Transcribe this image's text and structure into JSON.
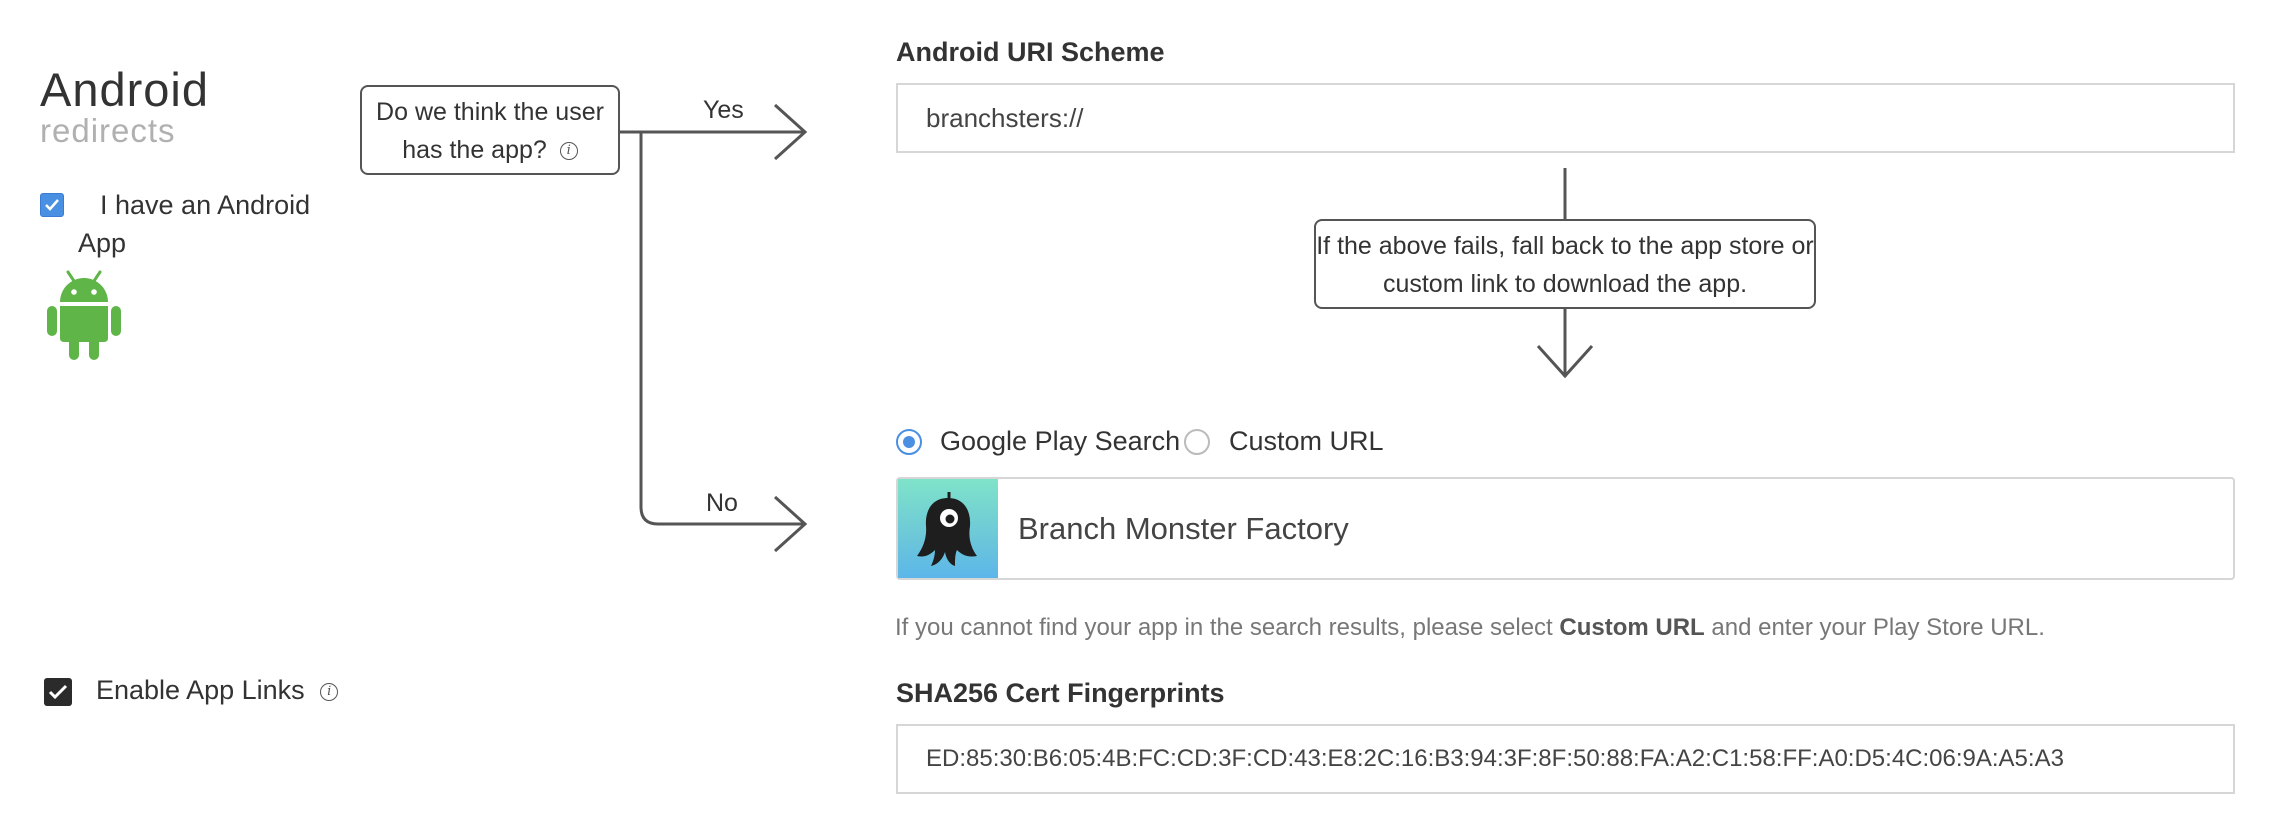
{
  "section": {
    "title": "Android",
    "subtitle": "redirects"
  },
  "android_app": {
    "checkbox_label": "I have an Android App",
    "checked": true,
    "logo_icon": "android-robot-icon",
    "logo_color": "#5fb548"
  },
  "flow": {
    "question": "Do we think the user has the app?",
    "yes_label": "Yes",
    "no_label": "No",
    "fallback_text": "If the above fails, fall back to the app store or custom link to download the app."
  },
  "uri_scheme": {
    "label": "Android URI Scheme",
    "value": "branchsters://"
  },
  "fallback_choice": {
    "options": [
      {
        "label": "Google Play Search",
        "selected": true
      },
      {
        "label": "Custom URL",
        "selected": false
      }
    ],
    "accent_color": "#4a90e2"
  },
  "app_search": {
    "result_name": "Branch Monster Factory",
    "result_icon": "branch-monster-icon"
  },
  "helper": {
    "prefix": "If you cannot find your app in the search results, please select",
    "emphasis": "Custom URL",
    "suffix": "and enter your Play Store URL."
  },
  "app_links": {
    "label": "Enable App Links",
    "checked": true
  },
  "sha256": {
    "label": "SHA256 Cert Fingerprints",
    "value": "ED:85:30:B6:05:4B:FC:CD:3F:CD:43:E8:2C:16:B3:94:3F:8F:50:88:FA:A2:C1:58:FF:A0:D5:4C:06:9A:A5:A3"
  }
}
